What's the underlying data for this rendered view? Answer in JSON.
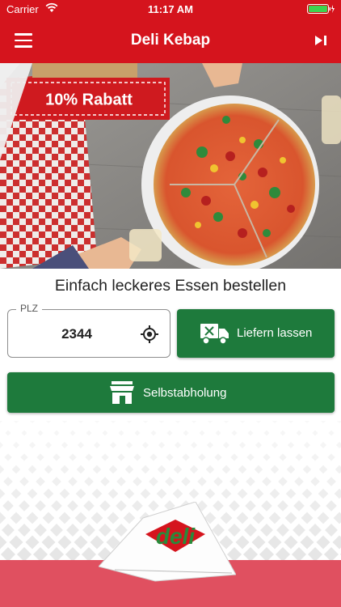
{
  "status_bar": {
    "carrier": "Carrier",
    "time": "11:17 AM"
  },
  "nav": {
    "title": "Deli Kebap"
  },
  "hero": {
    "discount_label": "10% Rabatt"
  },
  "main": {
    "subtitle": "Einfach leckeres Essen bestellen",
    "plz": {
      "label": "PLZ",
      "value": "2344"
    },
    "deliver_button": "Liefern lassen",
    "pickup_button": "Selbstabholung"
  },
  "logo": {
    "text": "deli"
  },
  "colors": {
    "brand_red": "#d5141d",
    "action_green": "#1e7a3c",
    "footer_pink": "#e05060"
  }
}
